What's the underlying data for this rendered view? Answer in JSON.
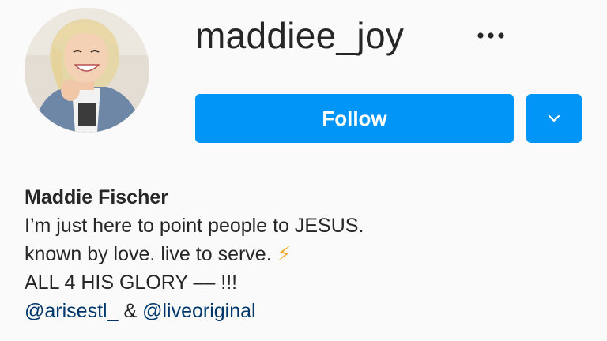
{
  "profile": {
    "username": "maddiee_joy",
    "more_icon": "ellipsis-icon",
    "follow_label": "Follow",
    "dropdown_icon": "chevron-down-icon",
    "accent_color": "#0095f6",
    "display_name": "Maddie Fischer",
    "bio_lines": [
      "I’m just here to point people to JESUS.",
      "known by love. live to serve.",
      "ALL 4 HIS GLORY –– !!!"
    ],
    "bio_emoji": "⚡",
    "mentions": [
      "@arisestl_",
      "@liveoriginal"
    ],
    "mention_separator": "&",
    "mention_color": "#00376b"
  }
}
